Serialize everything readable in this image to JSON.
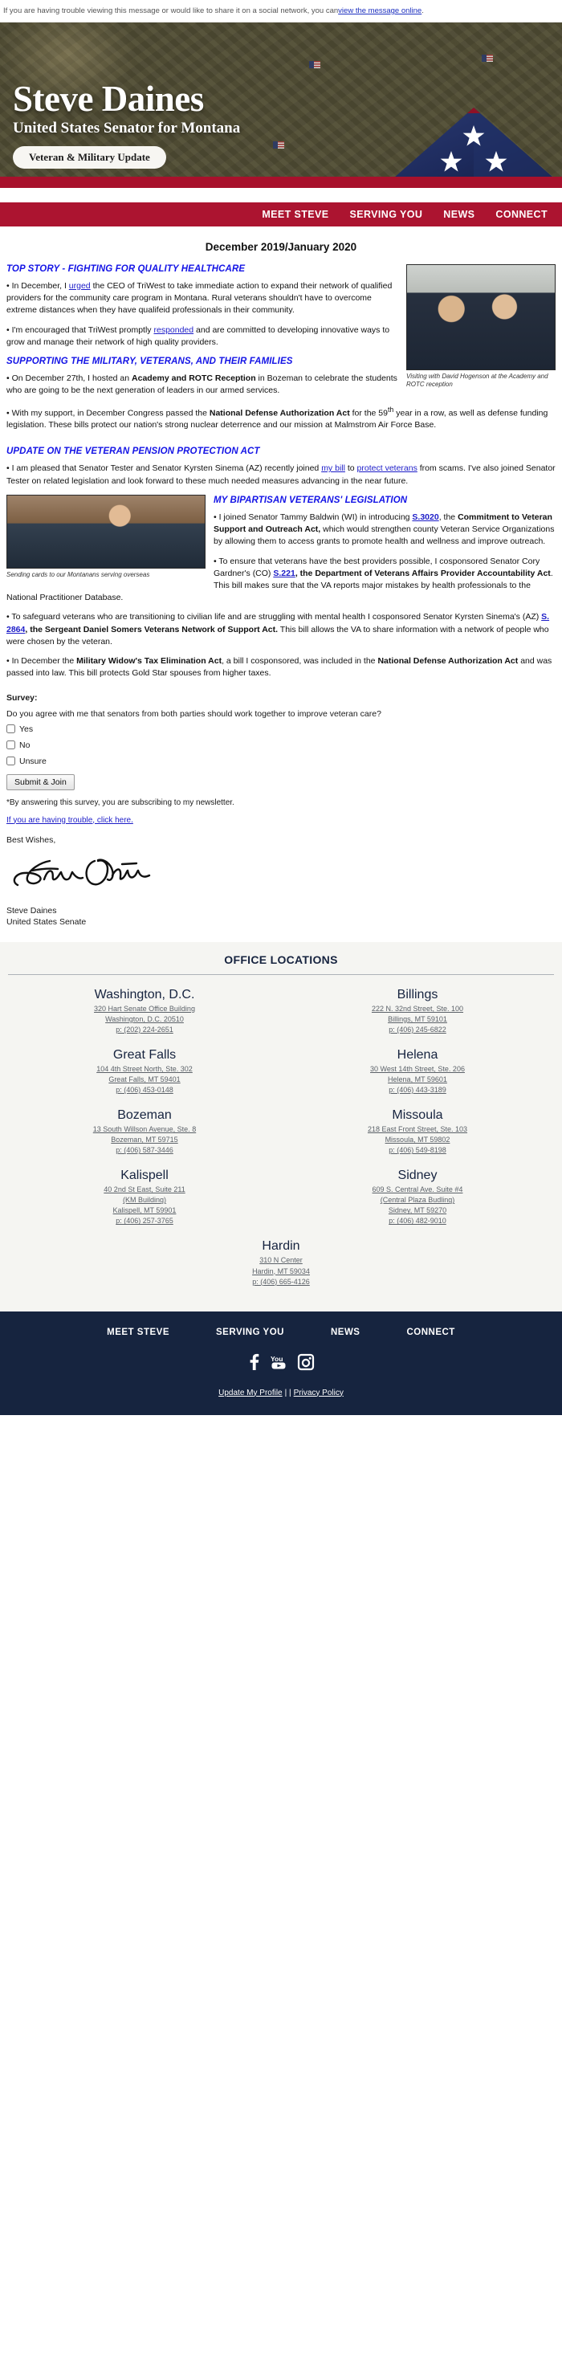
{
  "preheader": {
    "text_before": "If you are having trouble viewing this message or would like to share it on a social network, you can ",
    "link": "view the message online",
    "text_after": "."
  },
  "hero": {
    "name": "Steve Daines",
    "subtitle": "United States Senator for Montana",
    "pill": "Veteran & Military Update"
  },
  "nav": {
    "items": [
      {
        "label": "MEET STEVE"
      },
      {
        "label": "SERVING YOU"
      },
      {
        "label": "NEWS"
      },
      {
        "label": "CONNECT"
      }
    ]
  },
  "main": {
    "issue_date": "December 2019/January 2020",
    "section1_heading": "TOP STORY - FIGHTING FOR QUALITY HEALTHCARE",
    "p1_a": "• In December, I ",
    "p1_link": "urged",
    "p1_b": " the CEO of TriWest to take immediate action to expand their network of qualified providers for the community care program in Montana. Rural veterans shouldn't have to overcome extreme distances when they have qualifeid professionals in their community.",
    "p2_a": "• I'm encouraged that TriWest promptly ",
    "p2_link": "responded",
    "p2_b": " and are committed to developing innovative ways to grow and manage their network of high quality providers.",
    "section2_heading": "SUPPORTING THE MILITARY, VETERANS, AND THEIR FAMILIES",
    "p3_a": "• On December 27th, I hosted an ",
    "p3_bold": "Academy and ROTC Reception",
    "p3_b": " in Bozeman to celebrate the students who are going to be the next generation of leaders in our armed services.",
    "p4_a": "• With my support, in December Congress passed the ",
    "p4_bold": "National Defense Authorization Act",
    "p4_b": " for the 59",
    "p4_sup": "th",
    "p4_c": " year in a row, as well as defense funding legislation. These bills protect our nation's strong nuclear deterrence and our mission at Malmstrom Air Force Base.",
    "caption1": "Visiting with David Hogenson at the Academy and ROTC reception",
    "section3_heading": "UPDATE ON THE VETERAN PENSION PROTECTION ACT",
    "p5_a": "• I am pleased that Senator Tester and Senator Kyrsten Sinema (AZ) recently joined ",
    "p5_link1": "my bill",
    "p5_b": " to ",
    "p5_link2": "protect veterans",
    "p5_c": " from scams. I've also joined Senator Tester on related legislation and look forward to these much needed measures advancing in the near future.",
    "caption2": "Sending cards to our Montanans serving overseas",
    "section4_heading": "MY BIPARTISAN VETERANS' LEGISLATION",
    "p6_a": "• I joined Senator Tammy Baldwin (WI) in introducing ",
    "p6_link": "S.3020",
    "p6_b": ", the ",
    "p6_bold": "Commitment to Veteran Support and Outreach Act,",
    "p6_c": " which would strengthen county Veteran Service Organizations by allowing them to access grants to promote health and wellness and improve outreach.",
    "p7_a": "• To ensure that veterans have the best providers possible, I cosponsored Senator Cory Gardner's (CO) ",
    "p7_link": "S.221",
    "p7_bold": ", the Department of Veterans Affairs Provider Accountability Act",
    "p7_b": ". This bill makes sure that the VA reports major mistakes by health professionals to the National Practitioner Database.",
    "p8_a": "• To safeguard veterans who are transitioning to civilian life and are struggling with mental health I cosponsored Senator Kyrsten Sinema's (AZ) ",
    "p8_link": "S. 2864",
    "p8_bold": ", the Sergeant Daniel Somers Veterans Network of Support Act.",
    "p8_b": " This bill allows the VA to share information with a network of people who were chosen by the veteran.",
    "p9_a": "• In December the ",
    "p9_bold1": "Military Widow's Tax Elimination Act",
    "p9_b": ", a bill I cosponsored, was included in the ",
    "p9_bold2": "National Defense Authorization Act",
    "p9_c": " and was passed into law. This bill protects Gold Star spouses from higher taxes."
  },
  "survey": {
    "title": "Survey:",
    "question": "Do you agree with me that senators from both parties should work together to improve veteran care?",
    "options": [
      {
        "label": "Yes"
      },
      {
        "label": "No"
      },
      {
        "label": "Unsure"
      }
    ],
    "submit_label": "Submit & Join",
    "fineprint": "*By answering this survey, you are subscribing to my newsletter.",
    "trouble_link": "If you are having trouble, click here."
  },
  "signature": {
    "best_wishes": "Best Wishes,",
    "name": "Steve Daines",
    "title": "United States Senate"
  },
  "offices": {
    "title": "OFFICE LOCATIONS",
    "list": [
      {
        "city": "Washington, D.C.",
        "line1": "320 Hart Senate Office Building",
        "line2": "Washington, D.C. 20510",
        "line3": "",
        "phone": "p: (202) 224-2651"
      },
      {
        "city": "Billings",
        "line1": "222 N. 32nd Street, Ste. 100",
        "line2": "Billings, MT 59101",
        "line3": "",
        "phone": "p: (406) 245-6822"
      },
      {
        "city": "Great Falls",
        "line1": "104 4th Street North, Ste. 302",
        "line2": "Great Falls, MT 59401",
        "line3": "",
        "phone": "p: (406) 453-0148"
      },
      {
        "city": "Helena",
        "line1": "30 West 14th Street, Ste. 206",
        "line2": "Helena, MT 59601",
        "line3": "",
        "phone": "p: (406) 443-3189"
      },
      {
        "city": "Bozeman",
        "line1": "13 South Willson Avenue, Ste. 8",
        "line2": "Bozeman, MT 59715",
        "line3": "",
        "phone": "p: (406) 587-3446"
      },
      {
        "city": "Missoula",
        "line1": "218 East Front Street, Ste. 103",
        "line2": "Missoula, MT 59802",
        "line3": "",
        "phone": "p: (406) 549-8198"
      },
      {
        "city": "Kalispell",
        "line1": "40 2nd St East, Suite 211",
        "line2": "(KM Building)",
        "line3": "Kalispell, MT 59901",
        "phone": "p: (406) 257-3765"
      },
      {
        "city": "Sidney",
        "line1": "609 S. Central Ave. Suite #4",
        "line2": "(Central Plaza Budling)",
        "line3": "Sidney, MT 59270",
        "phone": "p: (406) 482-9010"
      },
      {
        "city": "Hardin",
        "line1": "310 N Center",
        "line2": "Hardin, MT 59034",
        "line3": "",
        "phone": "p: (406) 665-4126"
      }
    ]
  },
  "footer": {
    "nav": [
      {
        "label": "MEET STEVE"
      },
      {
        "label": "SERVING YOU"
      },
      {
        "label": "NEWS"
      },
      {
        "label": "CONNECT"
      }
    ],
    "social": [
      {
        "name": "facebook-icon"
      },
      {
        "name": "youtube-icon"
      },
      {
        "name": "instagram-icon"
      }
    ],
    "update_profile": "Update My Profile",
    "separator": "|  |",
    "privacy": "Privacy Policy"
  },
  "colors": {
    "nav_red": "#ac1430",
    "band_red": "#a8112c",
    "footer_navy": "#16243f",
    "heading_blue": "#1414e6",
    "link_blue": "#1c1cc8"
  }
}
